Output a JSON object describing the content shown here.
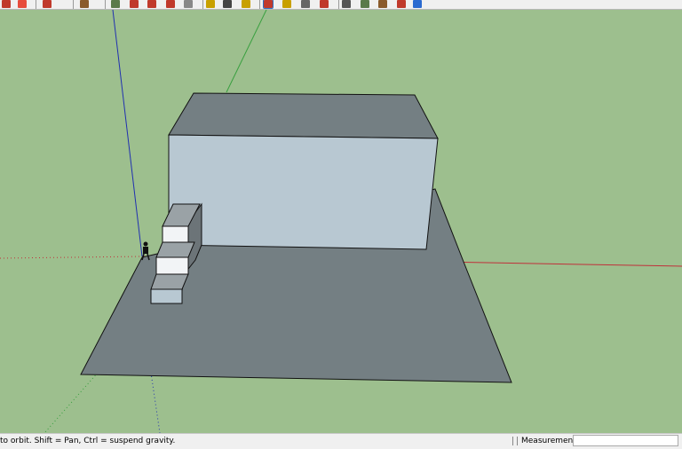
{
  "toolbar": {
    "icons": [
      {
        "name": "freehand-icon",
        "color": "#c0392b"
      },
      {
        "name": "eraser-icon",
        "color": "#e74c3c"
      },
      {
        "name": "rotated-rectangle-icon",
        "color": "#c0392b"
      },
      {
        "name": "paint-bucket-icon",
        "color": "#8a5a2b"
      },
      {
        "name": "push-pull-icon",
        "color": "#5a7a4a"
      },
      {
        "name": "follow-me-icon",
        "color": "#c0392b"
      },
      {
        "name": "move-icon",
        "color": "#c0392b"
      },
      {
        "name": "rotate-icon",
        "color": "#c0392b"
      },
      {
        "name": "scale-icon",
        "color": "#888888"
      },
      {
        "name": "tape-measure-icon",
        "color": "#c8a000"
      },
      {
        "name": "dimension-icon",
        "color": "#444444"
      },
      {
        "name": "text-icon",
        "color": "#c8a000"
      },
      {
        "name": "orbit-icon",
        "color": "#c0392b"
      },
      {
        "name": "pan-icon",
        "color": "#c8a000"
      },
      {
        "name": "look-around-icon",
        "color": "#666666"
      },
      {
        "name": "walk-icon",
        "color": "#c0392b"
      },
      {
        "name": "position-camera-icon",
        "color": "#555555"
      },
      {
        "name": "section-plane-icon",
        "color": "#5a7a4a"
      },
      {
        "name": "warehouse-icon",
        "color": "#8a5a2b"
      },
      {
        "name": "extension-icon",
        "color": "#c0392b"
      },
      {
        "name": "share-model-icon",
        "color": "#2a6ad0"
      }
    ]
  },
  "status": {
    "hint": "to orbit. Shift = Pan, Ctrl = suspend gravity.",
    "measurements_label": "Measurements",
    "measurements_value": ""
  },
  "colors": {
    "sky_ground": "#9dbf8e",
    "ground_plane": "#747f83",
    "box_front": "#b8c8d2",
    "box_top": "#747f83",
    "stair_riser": "#f2f4f6",
    "stair_tread": "#9aa2a6",
    "axis_red": "#c0303a",
    "axis_green": "#3aa040",
    "axis_blue": "#2030b0"
  }
}
